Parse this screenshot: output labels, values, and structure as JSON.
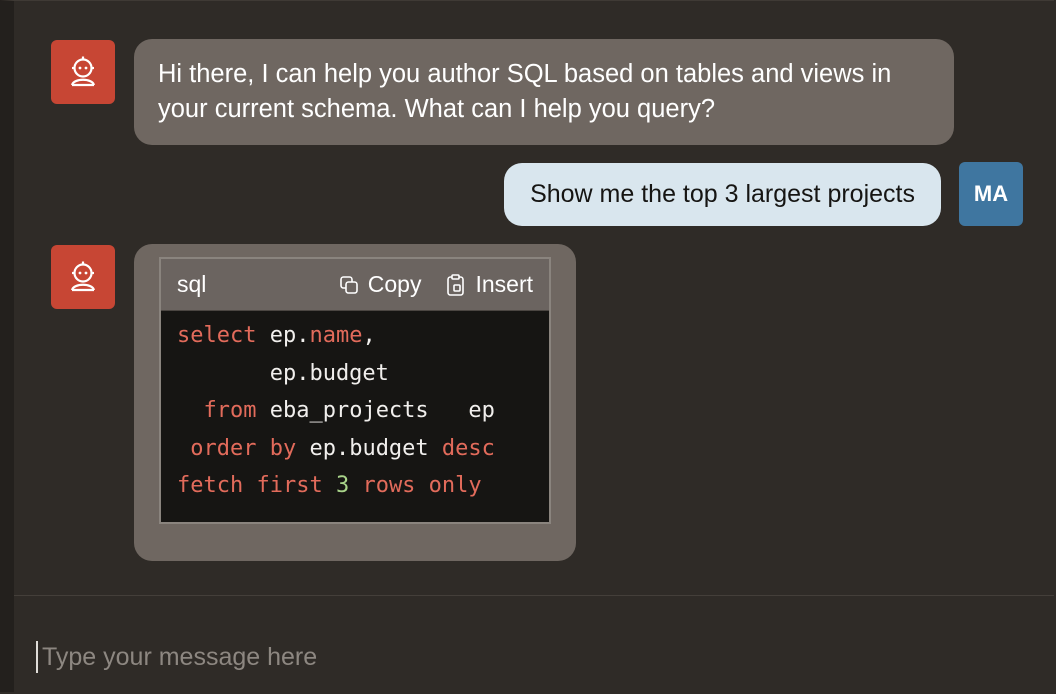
{
  "chat": {
    "bot_message_1": "Hi there, I can help you author SQL based on tables and views in your current schema. What can I help you query?",
    "user_message": "Show me the top 3 largest projects",
    "user_initials": "MA"
  },
  "code_block": {
    "language": "sql",
    "copy_label": "Copy",
    "insert_label": "Insert",
    "lines": [
      [
        {
          "t": "select",
          "k": "kw"
        },
        {
          "t": " ep.",
          "k": ""
        },
        {
          "t": "name",
          "k": "kw"
        },
        {
          "t": ",",
          "k": ""
        }
      ],
      [
        {
          "t": "       ep.budget",
          "k": ""
        }
      ],
      [
        {
          "t": "  from",
          "k": "kw"
        },
        {
          "t": " eba_projects   ep",
          "k": ""
        }
      ],
      [
        {
          "t": " order by",
          "k": "kw"
        },
        {
          "t": " ep.budget ",
          "k": ""
        },
        {
          "t": "desc",
          "k": "kw"
        }
      ],
      [
        {
          "t": "fetch first ",
          "k": "kw"
        },
        {
          "t": "3",
          "k": "num"
        },
        {
          "t": " rows only",
          "k": "kw"
        }
      ]
    ]
  },
  "composer": {
    "placeholder": "Type your message here"
  },
  "colors": {
    "bot_avatar": "#c74634",
    "user_avatar": "#3f76a0",
    "bot_bubble": "#6f6761",
    "user_bubble": "#d9e6ee",
    "sql_keyword": "#e26b5b",
    "sql_number": "#a9d48a"
  },
  "icons": {
    "bot_avatar": "robot-icon",
    "copy": "copy-icon",
    "insert": "clipboard-insert-icon"
  }
}
